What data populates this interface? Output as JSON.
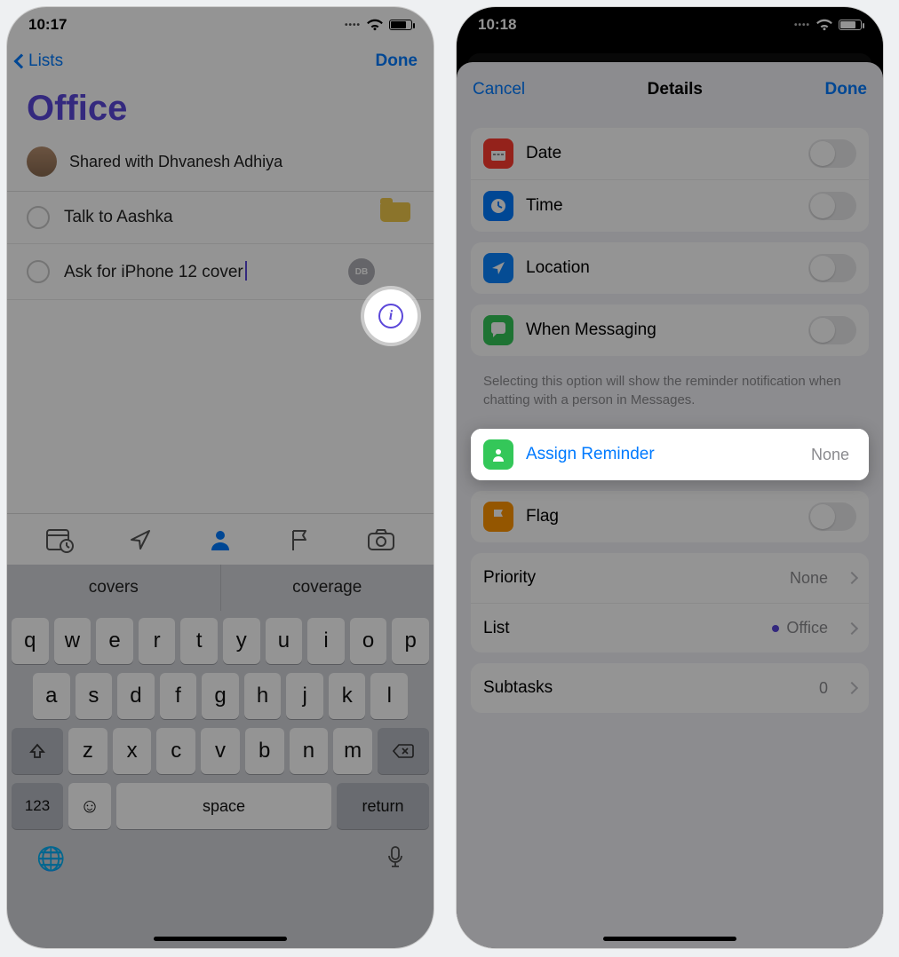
{
  "left": {
    "status": {
      "time": "10:17"
    },
    "nav": {
      "back": "Lists",
      "done": "Done"
    },
    "title": "Office",
    "shared_with": "Shared with Dhvanesh Adhiya",
    "reminders": [
      {
        "text": "Talk to Aashka"
      },
      {
        "text": "Ask for iPhone 12 cover",
        "assignee_chip": "DB"
      }
    ],
    "suggestions": [
      "covers",
      "coverage"
    ],
    "keyboard": {
      "row1": [
        "q",
        "w",
        "e",
        "r",
        "t",
        "y",
        "u",
        "i",
        "o",
        "p"
      ],
      "row2": [
        "a",
        "s",
        "d",
        "f",
        "g",
        "h",
        "j",
        "k",
        "l"
      ],
      "row3": [
        "z",
        "x",
        "c",
        "v",
        "b",
        "n",
        "m"
      ],
      "sym": "123",
      "space": "space",
      "return": "return"
    }
  },
  "right": {
    "status": {
      "time": "10:18"
    },
    "nav": {
      "cancel": "Cancel",
      "title": "Details",
      "done": "Done"
    },
    "cells": {
      "date": "Date",
      "time": "Time",
      "location": "Location",
      "when_messaging": "When Messaging",
      "assign": "Assign Reminder",
      "assign_value": "None",
      "flag": "Flag",
      "priority": "Priority",
      "priority_value": "None",
      "list": "List",
      "list_value": "Office",
      "subtasks": "Subtasks",
      "subtasks_value": "0"
    },
    "help": "Selecting this option will show the reminder notification when chatting with a person in Messages."
  }
}
